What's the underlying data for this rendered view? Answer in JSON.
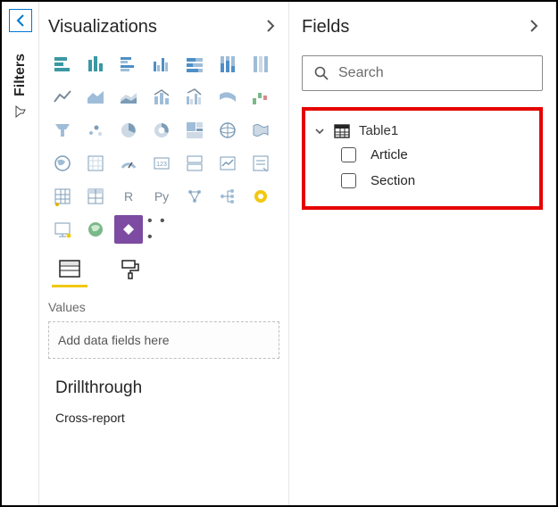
{
  "rail": {
    "filters_label": "Filters"
  },
  "viz": {
    "title": "Visualizations",
    "tabs": {
      "values_label": "Values"
    },
    "drop_placeholder": "Add data fields here",
    "drill_title": "Drillthrough",
    "drill_sub": "Cross-report",
    "icons": [
      "stacked-bar-icon",
      "clustered-bar-icon",
      "stacked-column-icon",
      "clustered-column-icon",
      "line-chart-icon",
      "area-chart-icon",
      "stacked-area-icon",
      "line-column-icon",
      "ribbon-chart-icon",
      "waterfall-icon",
      "scatter-chart-icon",
      "pie-chart-icon",
      "donut-chart-icon",
      "treemap-icon",
      "map-icon",
      "filled-map-icon",
      "gauge-icon",
      "card-icon",
      "multi-card-icon",
      "kpi-icon",
      "slicer-icon",
      "table-icon",
      "matrix-icon",
      "r-visual-icon",
      "python-visual-icon",
      "key-influencers-icon",
      "decomposition-icon",
      "smart-narrative-icon",
      "powerapps-icon",
      "more-visuals-icon"
    ],
    "r_label": "R",
    "py_label": "Py",
    "more_label": "• • •"
  },
  "fields": {
    "title": "Fields",
    "search_placeholder": "Search",
    "tables": [
      {
        "name": "Table1",
        "expanded": true,
        "fields": [
          {
            "name": "Article"
          },
          {
            "name": "Section"
          }
        ]
      }
    ]
  }
}
